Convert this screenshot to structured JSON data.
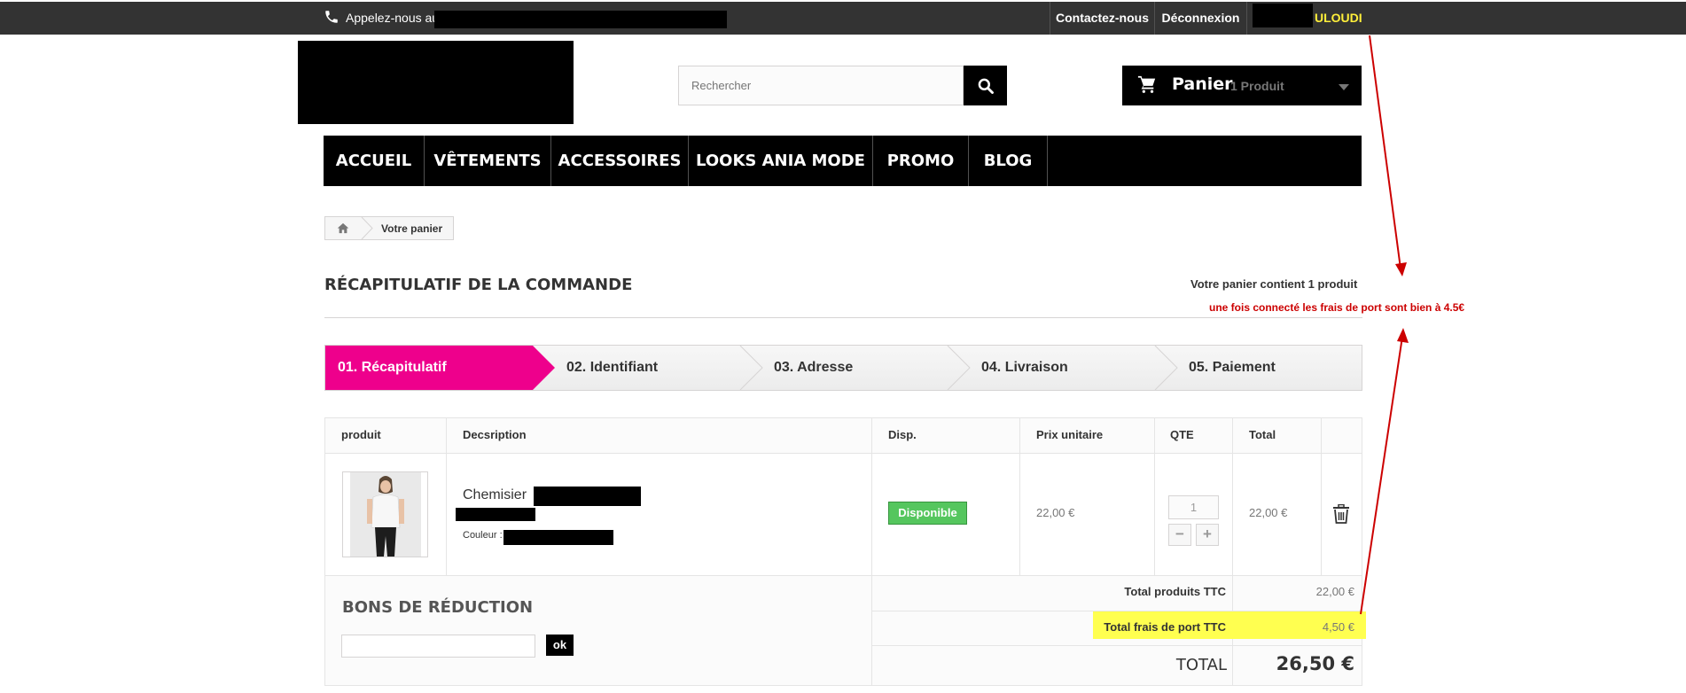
{
  "topbar": {
    "call_label": "Appelez-nous au:",
    "contact_label": "Contactez-nous",
    "logout_label": "Déconnexion",
    "user_name_visible": "ULOUDI",
    "user_name_color": "#ffef3a"
  },
  "search": {
    "placeholder": "Rechercher"
  },
  "cart_widget": {
    "label": "Panier",
    "count": "1 Produit"
  },
  "nav": {
    "items": [
      "ACCUEIL",
      "VÊTEMENTS",
      "ACCESSOIRES",
      "LOOKS ANIA MODE",
      "PROMO",
      "BLOG"
    ]
  },
  "breadcrumb": {
    "current": "Votre panier"
  },
  "summary": {
    "title": "RÉCAPITULATIF DE LA COMMANDE",
    "cart_count_text": "Votre panier contient 1 produit",
    "annotation": "une fois connecté les frais de port sont bien à 4.5€",
    "annotation_color": "#cc0000"
  },
  "steps": [
    {
      "label": "01. Récapitulatif",
      "active": true
    },
    {
      "label": "02. Identifiant",
      "active": false
    },
    {
      "label": "03. Adresse",
      "active": false
    },
    {
      "label": "04. Livraison",
      "active": false
    },
    {
      "label": "05. Paiement",
      "active": false
    }
  ],
  "accent_color": "#ee008c",
  "table": {
    "headers": [
      "produit",
      "Decsription",
      "Disp.",
      "Prix unitaire",
      "QTE",
      "Total"
    ],
    "row": {
      "name": "Chemisier",
      "color_label": "Couleur :",
      "availability": "Disponible",
      "unit_price": "22,00 €",
      "quantity": "1",
      "total": "22,00 €"
    }
  },
  "vouchers": {
    "title": "BONS DE RÉDUCTION",
    "button": "ok"
  },
  "totals": {
    "products_label": "Total produits TTC",
    "products_value": "22,00 €",
    "shipping_label": "Total frais de port TTC",
    "shipping_value": "4,50 €",
    "grand_label": "TOTAL",
    "grand_value": "26,50 €",
    "highlight_color": "#ffff50"
  }
}
